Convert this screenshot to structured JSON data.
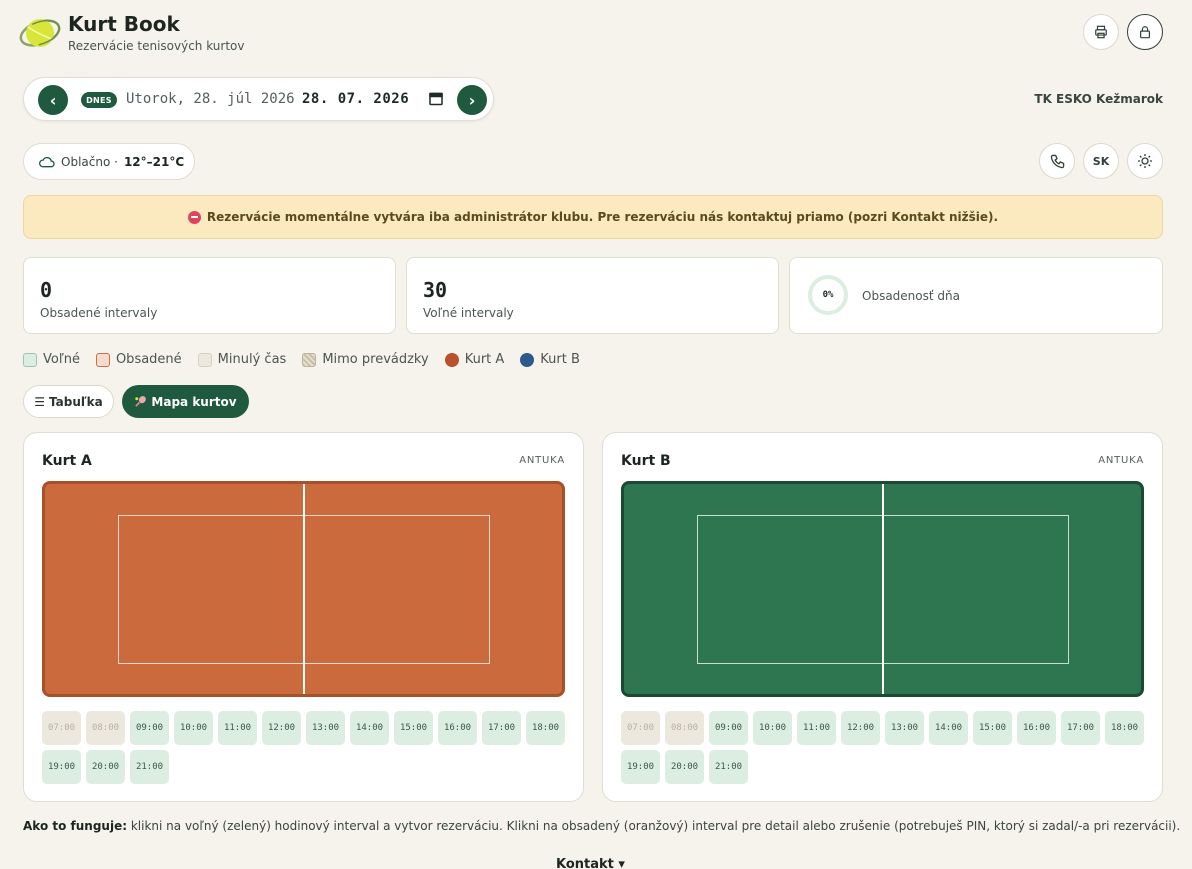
{
  "header": {
    "title": "Kurt Book",
    "subtitle": "Rezervácie tenisových kurtov",
    "print_icon": "printer-icon",
    "lock_icon": "lock-icon"
  },
  "date_bar": {
    "prev_label": "‹",
    "next_label": "›",
    "today_badge": "DNES",
    "date_text": "Utorok, 28. júl 2026",
    "date_value": "28. 07. 2026"
  },
  "club_name": "TK ESKO Kežmarok",
  "weather": {
    "condition": "Oblačno ·",
    "temp": "12°–21°C"
  },
  "controls": {
    "language": "SK",
    "phone_icon": "phone-icon",
    "theme_icon": "sun-icon"
  },
  "alert": {
    "text": "Rezervácie momentálne vytvára iba administrátor klubu. Pre rezerváciu nás kontaktuj priamo (pozri Kontakt nižšie)."
  },
  "stats": {
    "occupied_count": "0",
    "occupied_label": "Obsadené intervaly",
    "free_count": "30",
    "free_label": "Voľné intervaly",
    "occupancy_percent": "0%",
    "occupancy_label": "Obsadenosť dňa"
  },
  "legend": {
    "free": "Voľné",
    "occupied": "Obsadené",
    "past": "Minulý čas",
    "closed": "Mimo prevádzky",
    "court_a": "Kurt A",
    "court_b": "Kurt B"
  },
  "view": {
    "table_label": "Tabuľka",
    "map_label": "Mapa kurtov"
  },
  "colors": {
    "accent": "#1f5a3f",
    "clay": "#cb6b3d",
    "grass": "#2d7650",
    "court_a_dot": "#b9512c",
    "court_b_dot": "#2c5a8c"
  },
  "courts": [
    {
      "name": "Kurt A",
      "surface": "ANTUKA",
      "slots": [
        {
          "time": "07:00",
          "state": "past"
        },
        {
          "time": "08:00",
          "state": "past"
        },
        {
          "time": "09:00",
          "state": "free"
        },
        {
          "time": "10:00",
          "state": "free"
        },
        {
          "time": "11:00",
          "state": "free"
        },
        {
          "time": "12:00",
          "state": "free"
        },
        {
          "time": "13:00",
          "state": "free"
        },
        {
          "time": "14:00",
          "state": "free"
        },
        {
          "time": "15:00",
          "state": "free"
        },
        {
          "time": "16:00",
          "state": "free"
        },
        {
          "time": "17:00",
          "state": "free"
        },
        {
          "time": "18:00",
          "state": "free"
        },
        {
          "time": "19:00",
          "state": "free"
        },
        {
          "time": "20:00",
          "state": "free"
        },
        {
          "time": "21:00",
          "state": "free"
        }
      ]
    },
    {
      "name": "Kurt B",
      "surface": "ANTUKA",
      "slots": [
        {
          "time": "07:00",
          "state": "past"
        },
        {
          "time": "08:00",
          "state": "past"
        },
        {
          "time": "09:00",
          "state": "free"
        },
        {
          "time": "10:00",
          "state": "free"
        },
        {
          "time": "11:00",
          "state": "free"
        },
        {
          "time": "12:00",
          "state": "free"
        },
        {
          "time": "13:00",
          "state": "free"
        },
        {
          "time": "14:00",
          "state": "free"
        },
        {
          "time": "15:00",
          "state": "free"
        },
        {
          "time": "16:00",
          "state": "free"
        },
        {
          "time": "17:00",
          "state": "free"
        },
        {
          "time": "18:00",
          "state": "free"
        },
        {
          "time": "19:00",
          "state": "free"
        },
        {
          "time": "20:00",
          "state": "free"
        },
        {
          "time": "21:00",
          "state": "free"
        }
      ]
    }
  ],
  "howto": {
    "label": "Ako to funguje:",
    "text": "klikni na voľný (zelený) hodinový interval a vytvor rezerváciu. Klikni na obsadený (oranžový) interval pre detail alebo zrušenie (potrebuješ PIN, ktorý si zadal/-a pri rezervácii)."
  },
  "footer": {
    "contact": "Kontakt ▾"
  }
}
